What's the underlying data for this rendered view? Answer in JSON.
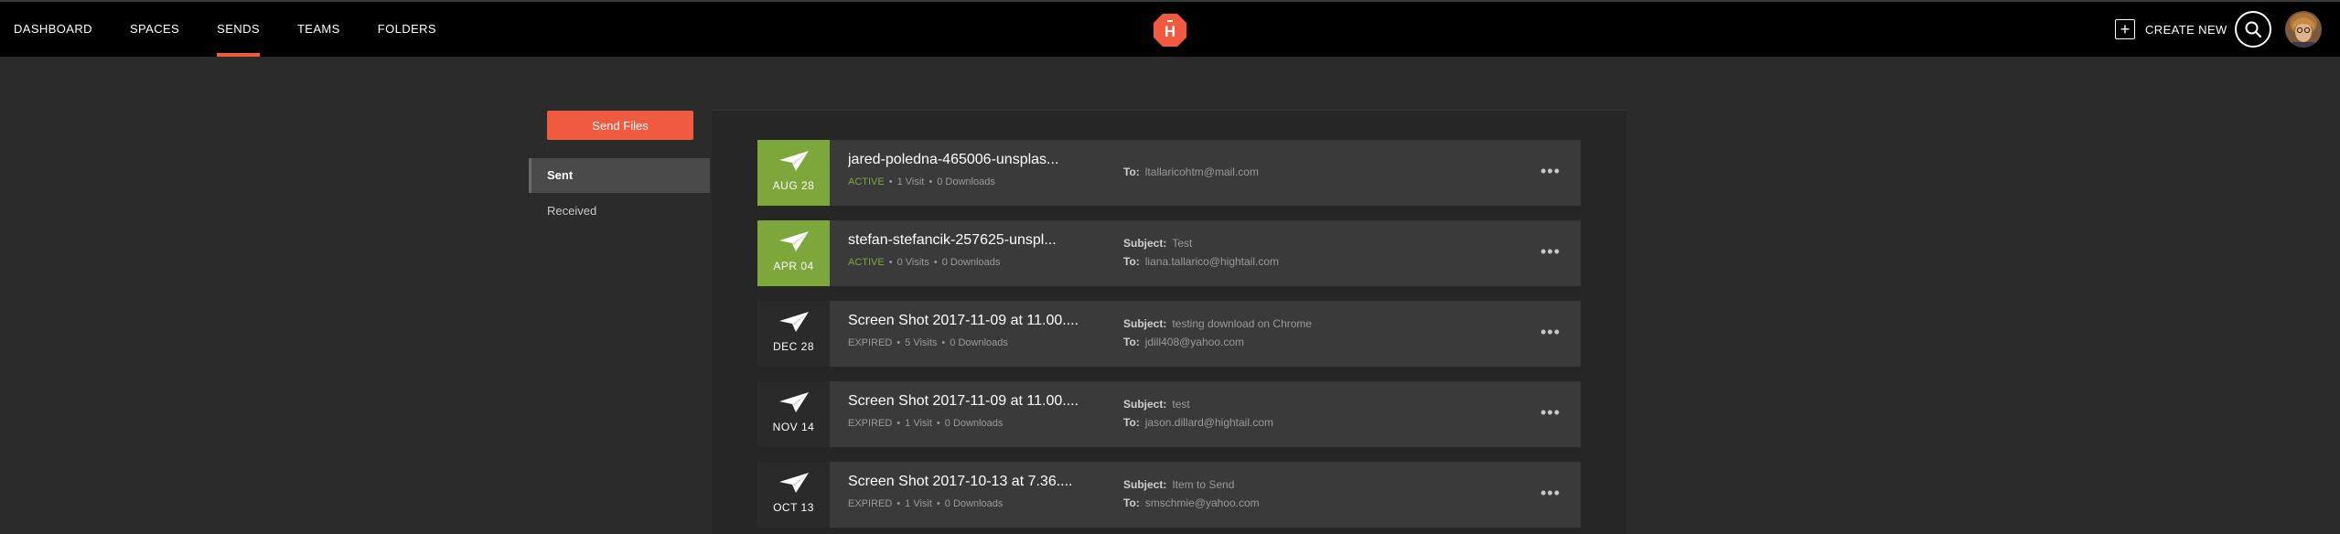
{
  "nav": {
    "items": [
      {
        "label": "DASHBOARD"
      },
      {
        "label": "SPACES"
      },
      {
        "label": "SENDS",
        "active": true
      },
      {
        "label": "TEAMS"
      },
      {
        "label": "FOLDERS"
      }
    ],
    "create_label": "CREATE NEW",
    "logo_letter": "H"
  },
  "sidebar": {
    "send_button": "Send Files",
    "items": [
      {
        "label": "Sent",
        "active": true
      },
      {
        "label": "Received"
      }
    ]
  },
  "colors": {
    "accent": "#f05a3e",
    "active_green": "#7ea73b"
  },
  "sends": [
    {
      "date": "AUG 28",
      "status": "ACTIVE",
      "name": "jared-poledna-465006-unsplas...",
      "visits": "1 Visit",
      "downloads": "0 Downloads",
      "subject_label": "",
      "subject": "",
      "to_label": "To:",
      "to": "ltallaricohtm@mail.com"
    },
    {
      "date": "APR 04",
      "status": "ACTIVE",
      "name": "stefan-stefancik-257625-unspl...",
      "visits": "0 Visits",
      "downloads": "0 Downloads",
      "subject_label": "Subject:",
      "subject": "Test",
      "to_label": "To:",
      "to": "liana.tallarico@hightail.com"
    },
    {
      "date": "DEC 28",
      "status": "EXPIRED",
      "name": "Screen Shot 2017-11-09 at 11.00....",
      "visits": "5 Visits",
      "downloads": "0 Downloads",
      "subject_label": "Subject:",
      "subject": "testing download on Chrome",
      "to_label": "To:",
      "to": "jdill408@yahoo.com"
    },
    {
      "date": "NOV 14",
      "status": "EXPIRED",
      "name": "Screen Shot 2017-11-09 at 11.00....",
      "visits": "1 Visit",
      "downloads": "0 Downloads",
      "subject_label": "Subject:",
      "subject": "test",
      "to_label": "To:",
      "to": "jason.dillard@hightail.com"
    },
    {
      "date": "OCT 13",
      "status": "EXPIRED",
      "name": "Screen Shot 2017-10-13 at 7.36....",
      "visits": "1 Visit",
      "downloads": "0 Downloads",
      "subject_label": "Subject:",
      "subject": "Item to Send",
      "to_label": "To:",
      "to": "smschmie@yahoo.com"
    }
  ],
  "more_glyph": "•••"
}
